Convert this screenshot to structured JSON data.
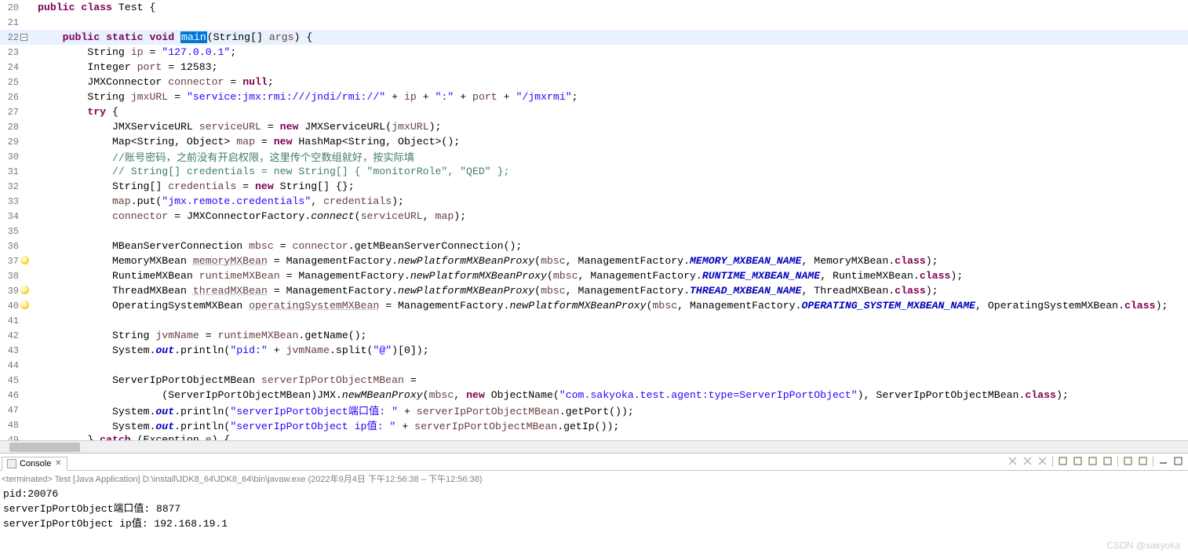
{
  "watermark": "CSDN @sakyoka",
  "console": {
    "tab_label": "Console",
    "status": "<terminated> Test [Java Application] D:\\install\\JDK8_64\\JDK8_64\\bin\\javaw.exe  (2022年9月4日 下午12:56:38 – 下午12:56:38)",
    "output_lines": [
      "pid:20076",
      "serverIpPortObject端口值: 8877",
      "serverIpPortObject ip值: 192.168.19.1"
    ]
  },
  "code": {
    "rows": [
      {
        "ln": 20,
        "marker": "",
        "hl": false,
        "segs": [
          {
            "t": "public ",
            "c": "kw"
          },
          {
            "t": "class ",
            "c": "kw"
          },
          {
            "t": "Test {",
            "c": ""
          }
        ],
        "indent": 0,
        "pre": ""
      },
      {
        "ln": 21,
        "marker": "",
        "hl": false,
        "segs": [],
        "pre": ""
      },
      {
        "ln": 22,
        "marker": "minus",
        "hl": true,
        "pre": "    ",
        "segs": [
          {
            "t": "public ",
            "c": "kw"
          },
          {
            "t": "static ",
            "c": "kw"
          },
          {
            "t": "void ",
            "c": "kw"
          },
          {
            "t": "main",
            "c": "hl"
          },
          {
            "t": "(String[] ",
            "c": ""
          },
          {
            "t": "args",
            "c": "param"
          },
          {
            "t": ") {",
            "c": ""
          }
        ]
      },
      {
        "ln": 23,
        "marker": "",
        "hl": false,
        "pre": "        ",
        "segs": [
          {
            "t": "String ",
            "c": ""
          },
          {
            "t": "ip",
            "c": "var"
          },
          {
            "t": " = ",
            "c": ""
          },
          {
            "t": "\"127.0.0.1\"",
            "c": "str"
          },
          {
            "t": ";",
            "c": ""
          }
        ]
      },
      {
        "ln": 24,
        "marker": "",
        "hl": false,
        "pre": "        ",
        "segs": [
          {
            "t": "Integer ",
            "c": ""
          },
          {
            "t": "port",
            "c": "var"
          },
          {
            "t": " = 12583;",
            "c": ""
          }
        ]
      },
      {
        "ln": 25,
        "marker": "",
        "hl": false,
        "pre": "        ",
        "segs": [
          {
            "t": "JMXConnector ",
            "c": ""
          },
          {
            "t": "connector",
            "c": "var"
          },
          {
            "t": " = ",
            "c": ""
          },
          {
            "t": "null",
            "c": "kw"
          },
          {
            "t": ";",
            "c": ""
          }
        ]
      },
      {
        "ln": 26,
        "marker": "",
        "hl": false,
        "pre": "        ",
        "segs": [
          {
            "t": "String ",
            "c": ""
          },
          {
            "t": "jmxURL",
            "c": "var"
          },
          {
            "t": " = ",
            "c": ""
          },
          {
            "t": "\"service:jmx:rmi:///jndi/rmi://\"",
            "c": "str"
          },
          {
            "t": " + ",
            "c": ""
          },
          {
            "t": "ip",
            "c": "var"
          },
          {
            "t": " + ",
            "c": ""
          },
          {
            "t": "\":\"",
            "c": "str"
          },
          {
            "t": " + ",
            "c": ""
          },
          {
            "t": "port",
            "c": "var"
          },
          {
            "t": " + ",
            "c": ""
          },
          {
            "t": "\"/jmxrmi\"",
            "c": "str"
          },
          {
            "t": ";",
            "c": ""
          }
        ]
      },
      {
        "ln": 27,
        "marker": "",
        "hl": false,
        "pre": "        ",
        "segs": [
          {
            "t": "try",
            "c": "kw"
          },
          {
            "t": " {",
            "c": ""
          }
        ]
      },
      {
        "ln": 28,
        "marker": "",
        "hl": false,
        "pre": "            ",
        "segs": [
          {
            "t": "JMXServiceURL ",
            "c": ""
          },
          {
            "t": "serviceURL",
            "c": "var"
          },
          {
            "t": " = ",
            "c": ""
          },
          {
            "t": "new",
            "c": "kw"
          },
          {
            "t": " JMXServiceURL(",
            "c": ""
          },
          {
            "t": "jmxURL",
            "c": "var"
          },
          {
            "t": ");",
            "c": ""
          }
        ]
      },
      {
        "ln": 29,
        "marker": "",
        "hl": false,
        "pre": "            ",
        "segs": [
          {
            "t": "Map<String, Object> ",
            "c": ""
          },
          {
            "t": "map",
            "c": "var"
          },
          {
            "t": " = ",
            "c": ""
          },
          {
            "t": "new",
            "c": "kw"
          },
          {
            "t": " HashMap<String, Object>();",
            "c": ""
          }
        ]
      },
      {
        "ln": 30,
        "marker": "",
        "hl": false,
        "pre": "            ",
        "segs": [
          {
            "t": "//账号密码，之前没有开启权限，这里传个空数组就好，按实际填",
            "c": "cmt"
          }
        ]
      },
      {
        "ln": 31,
        "marker": "",
        "hl": false,
        "pre": "            ",
        "segs": [
          {
            "t": "// String[] credentials = new String[] { \"monitorRole\", \"QED\" };",
            "c": "cmt"
          }
        ]
      },
      {
        "ln": 32,
        "marker": "",
        "hl": false,
        "pre": "            ",
        "segs": [
          {
            "t": "String[] ",
            "c": ""
          },
          {
            "t": "credentials",
            "c": "var"
          },
          {
            "t": " = ",
            "c": ""
          },
          {
            "t": "new",
            "c": "kw"
          },
          {
            "t": " String[] {};",
            "c": ""
          }
        ]
      },
      {
        "ln": 33,
        "marker": "",
        "hl": false,
        "pre": "            ",
        "segs": [
          {
            "t": "map",
            "c": "var"
          },
          {
            "t": ".put(",
            "c": ""
          },
          {
            "t": "\"jmx.remote.credentials\"",
            "c": "str"
          },
          {
            "t": ", ",
            "c": ""
          },
          {
            "t": "credentials",
            "c": "var"
          },
          {
            "t": ");",
            "c": ""
          }
        ]
      },
      {
        "ln": 34,
        "marker": "",
        "hl": false,
        "pre": "            ",
        "segs": [
          {
            "t": "connector",
            "c": "var"
          },
          {
            "t": " = JMXConnectorFactory.",
            "c": ""
          },
          {
            "t": "connect",
            "c": "it"
          },
          {
            "t": "(",
            "c": ""
          },
          {
            "t": "serviceURL",
            "c": "var"
          },
          {
            "t": ", ",
            "c": ""
          },
          {
            "t": "map",
            "c": "var"
          },
          {
            "t": ");",
            "c": ""
          }
        ]
      },
      {
        "ln": 35,
        "marker": "",
        "hl": false,
        "pre": "",
        "segs": []
      },
      {
        "ln": 36,
        "marker": "",
        "hl": false,
        "pre": "            ",
        "segs": [
          {
            "t": "MBeanServerConnection ",
            "c": ""
          },
          {
            "t": "mbsc",
            "c": "var"
          },
          {
            "t": " = ",
            "c": ""
          },
          {
            "t": "connector",
            "c": "var"
          },
          {
            "t": ".getMBeanServerConnection();",
            "c": ""
          }
        ]
      },
      {
        "ln": 37,
        "marker": "bulb",
        "hl": false,
        "pre": "            ",
        "segs": [
          {
            "t": "MemoryMXBean ",
            "c": ""
          },
          {
            "t": "memoryMXBean",
            "c": "var uline"
          },
          {
            "t": " = ManagementFactory.",
            "c": ""
          },
          {
            "t": "newPlatformMXBeanProxy",
            "c": "it"
          },
          {
            "t": "(",
            "c": ""
          },
          {
            "t": "mbsc",
            "c": "var"
          },
          {
            "t": ", ManagementFactory.",
            "c": ""
          },
          {
            "t": "MEMORY_MXBEAN_NAME",
            "c": "itb"
          },
          {
            "t": ", MemoryMXBean.",
            "c": ""
          },
          {
            "t": "class",
            "c": "kw"
          },
          {
            "t": ");",
            "c": ""
          }
        ]
      },
      {
        "ln": 38,
        "marker": "",
        "hl": false,
        "pre": "            ",
        "segs": [
          {
            "t": "RuntimeMXBean ",
            "c": ""
          },
          {
            "t": "runtimeMXBean",
            "c": "var"
          },
          {
            "t": " = ManagementFactory.",
            "c": ""
          },
          {
            "t": "newPlatformMXBeanProxy",
            "c": "it"
          },
          {
            "t": "(",
            "c": ""
          },
          {
            "t": "mbsc",
            "c": "var"
          },
          {
            "t": ", ManagementFactory.",
            "c": ""
          },
          {
            "t": "RUNTIME_MXBEAN_NAME",
            "c": "itb"
          },
          {
            "t": ", RuntimeMXBean.",
            "c": ""
          },
          {
            "t": "class",
            "c": "kw"
          },
          {
            "t": ");",
            "c": ""
          }
        ]
      },
      {
        "ln": 39,
        "marker": "bulb",
        "hl": false,
        "pre": "            ",
        "segs": [
          {
            "t": "ThreadMXBean ",
            "c": ""
          },
          {
            "t": "threadMXBean",
            "c": "var uline"
          },
          {
            "t": " = ManagementFactory.",
            "c": ""
          },
          {
            "t": "newPlatformMXBeanProxy",
            "c": "it"
          },
          {
            "t": "(",
            "c": ""
          },
          {
            "t": "mbsc",
            "c": "var"
          },
          {
            "t": ", ManagementFactory.",
            "c": ""
          },
          {
            "t": "THREAD_MXBEAN_NAME",
            "c": "itb"
          },
          {
            "t": ", ThreadMXBean.",
            "c": ""
          },
          {
            "t": "class",
            "c": "kw"
          },
          {
            "t": ");",
            "c": ""
          }
        ]
      },
      {
        "ln": 40,
        "marker": "bulb",
        "hl": false,
        "pre": "            ",
        "segs": [
          {
            "t": "OperatingSystemMXBean ",
            "c": ""
          },
          {
            "t": "operatingSystemMXBean",
            "c": "var uline"
          },
          {
            "t": " = ManagementFactory.",
            "c": ""
          },
          {
            "t": "newPlatformMXBeanProxy",
            "c": "it"
          },
          {
            "t": "(",
            "c": ""
          },
          {
            "t": "mbsc",
            "c": "var"
          },
          {
            "t": ", ManagementFactory.",
            "c": ""
          },
          {
            "t": "OPERATING_SYSTEM_MXBEAN_NAME",
            "c": "itb"
          },
          {
            "t": ", OperatingSystemMXBean.",
            "c": ""
          },
          {
            "t": "class",
            "c": "kw"
          },
          {
            "t": ");",
            "c": ""
          }
        ]
      },
      {
        "ln": 41,
        "marker": "",
        "hl": false,
        "pre": "",
        "segs": []
      },
      {
        "ln": 42,
        "marker": "",
        "hl": false,
        "pre": "            ",
        "segs": [
          {
            "t": "String ",
            "c": ""
          },
          {
            "t": "jvmName",
            "c": "var"
          },
          {
            "t": " = ",
            "c": ""
          },
          {
            "t": "runtimeMXBean",
            "c": "var"
          },
          {
            "t": ".getName();",
            "c": ""
          }
        ]
      },
      {
        "ln": 43,
        "marker": "",
        "hl": false,
        "pre": "            ",
        "segs": [
          {
            "t": "System.",
            "c": ""
          },
          {
            "t": "out",
            "c": "sf"
          },
          {
            "t": ".println(",
            "c": ""
          },
          {
            "t": "\"pid:\"",
            "c": "str"
          },
          {
            "t": " + ",
            "c": ""
          },
          {
            "t": "jvmName",
            "c": "var"
          },
          {
            "t": ".split(",
            "c": ""
          },
          {
            "t": "\"@\"",
            "c": "str"
          },
          {
            "t": ")[0]);",
            "c": ""
          }
        ]
      },
      {
        "ln": 44,
        "marker": "",
        "hl": false,
        "pre": "",
        "segs": []
      },
      {
        "ln": 45,
        "marker": "",
        "hl": false,
        "pre": "            ",
        "segs": [
          {
            "t": "ServerIpPortObjectMBean ",
            "c": ""
          },
          {
            "t": "serverIpPortObjectMBean",
            "c": "var"
          },
          {
            "t": " =",
            "c": ""
          }
        ]
      },
      {
        "ln": 46,
        "marker": "",
        "hl": false,
        "pre": "                    ",
        "segs": [
          {
            "t": "(ServerIpPortObjectMBean)JMX.",
            "c": ""
          },
          {
            "t": "newMBeanProxy",
            "c": "it"
          },
          {
            "t": "(",
            "c": ""
          },
          {
            "t": "mbsc",
            "c": "var"
          },
          {
            "t": ", ",
            "c": ""
          },
          {
            "t": "new",
            "c": "kw"
          },
          {
            "t": " ObjectName(",
            "c": ""
          },
          {
            "t": "\"com.sakyoka.test.agent:type=ServerIpPortObject\"",
            "c": "str"
          },
          {
            "t": "), ServerIpPortObjectMBean.",
            "c": ""
          },
          {
            "t": "class",
            "c": "kw"
          },
          {
            "t": ");",
            "c": ""
          }
        ]
      },
      {
        "ln": 47,
        "marker": "",
        "hl": false,
        "pre": "            ",
        "segs": [
          {
            "t": "System.",
            "c": ""
          },
          {
            "t": "out",
            "c": "sf"
          },
          {
            "t": ".println(",
            "c": ""
          },
          {
            "t": "\"serverIpPortObject端口值: \"",
            "c": "str"
          },
          {
            "t": " + ",
            "c": ""
          },
          {
            "t": "serverIpPortObjectMBean",
            "c": "var"
          },
          {
            "t": ".getPort());",
            "c": ""
          }
        ]
      },
      {
        "ln": 48,
        "marker": "",
        "hl": false,
        "pre": "            ",
        "segs": [
          {
            "t": "System.",
            "c": ""
          },
          {
            "t": "out",
            "c": "sf"
          },
          {
            "t": ".println(",
            "c": ""
          },
          {
            "t": "\"serverIpPortObject ip值: \"",
            "c": "str"
          },
          {
            "t": " + ",
            "c": ""
          },
          {
            "t": "serverIpPortObjectMBean",
            "c": "var"
          },
          {
            "t": ".getIp());",
            "c": ""
          }
        ]
      },
      {
        "ln": 49,
        "marker": "",
        "hl": false,
        "pre": "        ",
        "segs": [
          {
            "t": "} ",
            "c": ""
          },
          {
            "t": "catch",
            "c": "kw"
          },
          {
            "t": " (Exception ",
            "c": ""
          },
          {
            "t": "e",
            "c": "param"
          },
          {
            "t": ") {",
            "c": ""
          }
        ]
      }
    ]
  },
  "toolbar_icons": [
    "remove-launch-icon",
    "remove-all-icon",
    "clear-icon",
    "sep",
    "scroll-lock-icon",
    "show-console-icon",
    "pin-icon",
    "display-selected-icon",
    "sep",
    "open-console-icon",
    "new-console-icon",
    "sep",
    "minimize-icon",
    "maximize-icon"
  ]
}
